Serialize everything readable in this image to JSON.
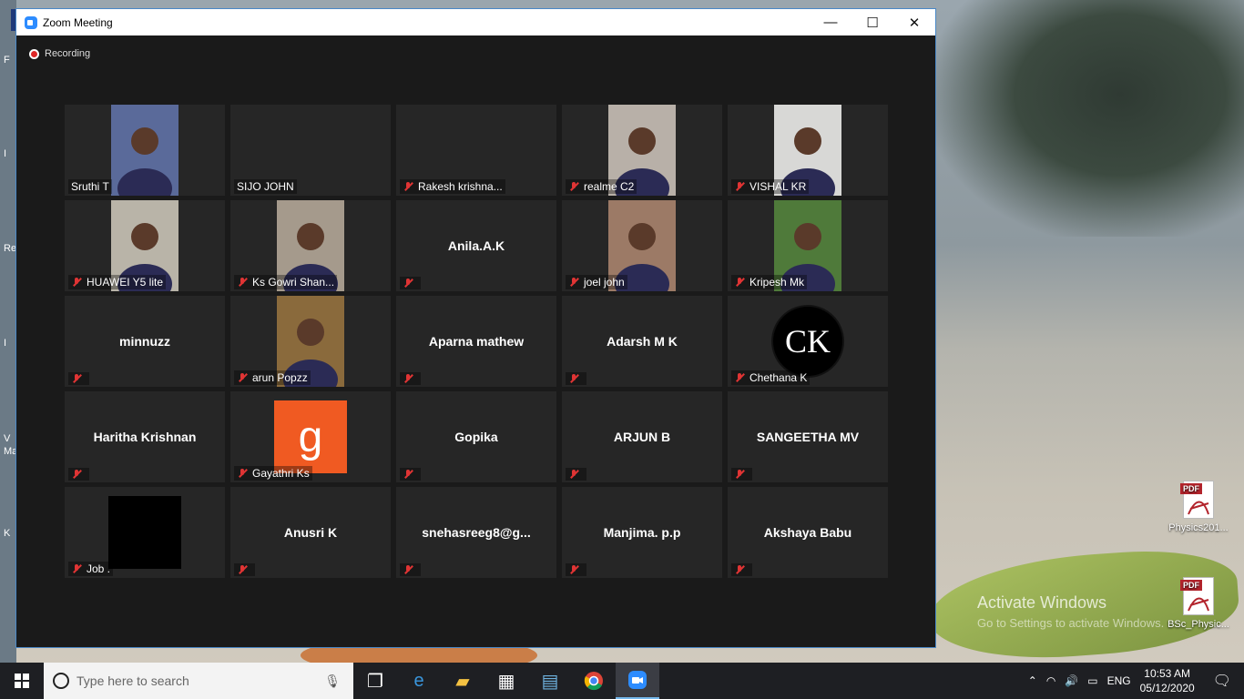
{
  "window": {
    "title": "Zoom Meeting",
    "minimize": "—",
    "maximize": "☐",
    "close": "✕"
  },
  "recording": {
    "label": "Recording"
  },
  "participants": [
    {
      "name": "Sruthi T",
      "display": "",
      "muted": false,
      "video": "person",
      "bg": "#5a6a9a"
    },
    {
      "name": "SIJO JOHN",
      "display": "",
      "muted": false,
      "video": "none"
    },
    {
      "name": "Rakesh krishna...",
      "display": "",
      "muted": true,
      "video": "none"
    },
    {
      "name": "realme C2",
      "display": "",
      "muted": true,
      "video": "person",
      "bg": "#b8b0a8"
    },
    {
      "name": "VISHAL KR",
      "display": "",
      "muted": true,
      "video": "person",
      "bg": "#d8d8d6"
    },
    {
      "name": "HUAWEI Y5 lite",
      "display": "",
      "muted": true,
      "video": "person",
      "bg": "#b9b4a8"
    },
    {
      "name": "Ks Gowri Shan...",
      "display": "",
      "muted": true,
      "video": "person",
      "bg": "#a59a8c"
    },
    {
      "name": "",
      "display": "Anila.A.K",
      "muted": true,
      "video": "none"
    },
    {
      "name": "joel john",
      "display": "",
      "muted": true,
      "video": "person",
      "bg": "#9c7a66"
    },
    {
      "name": "Kripesh Mk",
      "display": "",
      "muted": true,
      "video": "person",
      "bg": "#4f7a3a"
    },
    {
      "name": "",
      "display": "minnuzz",
      "muted": true,
      "video": "none"
    },
    {
      "name": "arun Popzz",
      "display": "",
      "muted": true,
      "video": "person",
      "bg": "#8a6a3c"
    },
    {
      "name": "",
      "display": "Aparna mathew",
      "muted": true,
      "video": "none"
    },
    {
      "name": "",
      "display": "Adarsh M K",
      "muted": true,
      "video": "none"
    },
    {
      "name": "Chethana K",
      "display": "",
      "muted": true,
      "video": "logo",
      "logo": "CK"
    },
    {
      "name": "",
      "display": "Haritha Krishnan",
      "muted": true,
      "video": "none"
    },
    {
      "name": "Gayathri Ks",
      "display": "",
      "muted": true,
      "video": "avatar",
      "avatar": "g",
      "bg": "#f05a22"
    },
    {
      "name": "",
      "display": "Gopika",
      "muted": true,
      "video": "none"
    },
    {
      "name": "",
      "display": "ARJUN B",
      "muted": true,
      "video": "none"
    },
    {
      "name": "",
      "display": "SANGEETHA MV",
      "muted": true,
      "video": "none"
    },
    {
      "name": "Job .",
      "display": "",
      "muted": true,
      "video": "black"
    },
    {
      "name": "",
      "display": "Anusri K",
      "muted": true,
      "video": "none"
    },
    {
      "name": "",
      "display": "snehasreeg8@g...",
      "muted": true,
      "video": "none"
    },
    {
      "name": "",
      "display": "Manjima. p.p",
      "muted": true,
      "video": "none"
    },
    {
      "name": "",
      "display": "Akshaya Babu",
      "muted": true,
      "video": "none"
    }
  ],
  "desktop": {
    "activate_title": "Activate Windows",
    "activate_sub": "Go to Settings to activate Windows.",
    "files": [
      {
        "label": "Physics201...",
        "badge": "PDF"
      },
      {
        "label": "BSc_Physic...",
        "badge": "PDF"
      }
    ],
    "left_labels": [
      "F",
      "I",
      "Re",
      "I",
      "V",
      "Ma",
      "K"
    ]
  },
  "taskbar": {
    "search_placeholder": "Type here to search",
    "lang": "ENG",
    "time": "10:53 AM",
    "date": "05/12/2020"
  }
}
